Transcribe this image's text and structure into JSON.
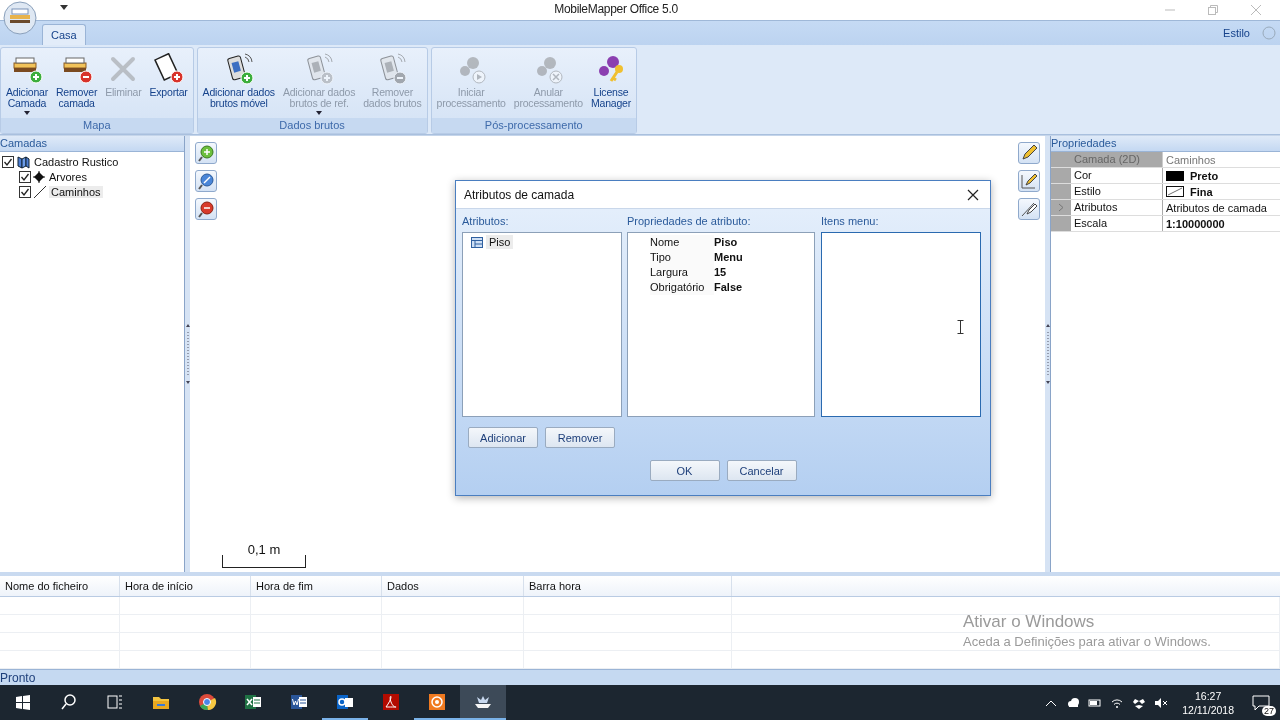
{
  "window": {
    "title": "MobileMapper Office 5.0"
  },
  "ribbon": {
    "tabs": [
      {
        "label": "Casa",
        "selected": true
      }
    ],
    "style_menu": {
      "label": "Estilo"
    },
    "groups": [
      {
        "label": "Mapa",
        "buttons": [
          {
            "label": "Adicionar\nCamada",
            "disabled": false,
            "dropdown": true
          },
          {
            "label": "Remover\ncamada",
            "disabled": false,
            "dropdown": false
          },
          {
            "label": "Eliminar",
            "disabled": true,
            "dropdown": false
          },
          {
            "label": "Exportar",
            "disabled": false,
            "dropdown": false
          }
        ]
      },
      {
        "label": "Dados brutos",
        "buttons": [
          {
            "label": "Adicionar dados\nbrutos móvel",
            "disabled": false,
            "dropdown": false
          },
          {
            "label": "Adicionar dados\nbrutos de ref.",
            "disabled": true,
            "dropdown": true
          },
          {
            "label": "Remover\ndados brutos",
            "disabled": true,
            "dropdown": false
          }
        ]
      },
      {
        "label": "Pós-processamento",
        "buttons": [
          {
            "label": "Iniciar\nprocessamento",
            "disabled": true,
            "dropdown": false
          },
          {
            "label": "Anular\nprocessamento",
            "disabled": true,
            "dropdown": false
          },
          {
            "label": "License\nManager",
            "disabled": false,
            "dropdown": false
          }
        ]
      }
    ]
  },
  "layers_panel": {
    "title": "Camadas",
    "tree": [
      {
        "label": "Cadastro Rustico",
        "kind": "group",
        "checked": true,
        "selected": false,
        "children": [
          {
            "label": "Arvores",
            "kind": "point",
            "checked": true,
            "selected": false
          },
          {
            "label": "Caminhos",
            "kind": "line",
            "checked": true,
            "selected": true
          }
        ]
      }
    ]
  },
  "map": {
    "scale": "0,1 m"
  },
  "properties_panel": {
    "title": "Propriedades",
    "rows": [
      {
        "name": "Camada (2D)",
        "value": "Caminhos",
        "kind": "header",
        "bold": false,
        "selected": false
      },
      {
        "name": "Cor",
        "value": "Preto",
        "kind": "color",
        "color": "#000000",
        "bold": true,
        "selected": false
      },
      {
        "name": "Estilo",
        "value": "Fina",
        "kind": "linestyle",
        "bold": true,
        "selected": false
      },
      {
        "name": "Atributos",
        "value": "Atributos de camada",
        "kind": "text",
        "bold": false,
        "selected": true
      },
      {
        "name": "Escala",
        "value": "1:10000000",
        "kind": "text",
        "bold": true,
        "selected": false
      }
    ]
  },
  "dialog": {
    "title": "Atributos de camada",
    "attributes": {
      "label": "Atributos:",
      "items": [
        {
          "label": "Piso",
          "selected": true
        }
      ]
    },
    "attribute_properties": {
      "label": "Propriedades de atributo:",
      "rows": [
        {
          "name": "Nome",
          "value": "Piso"
        },
        {
          "name": "Tipo",
          "value": "Menu"
        },
        {
          "name": "Largura",
          "value": "15"
        },
        {
          "name": "Obrigatório",
          "value": "False"
        }
      ]
    },
    "menu_items": {
      "label": "Itens menu:"
    },
    "list_buttons": [
      "Adicionar",
      "Remover"
    ],
    "buttons": [
      "OK",
      "Cancelar"
    ]
  },
  "files_table": {
    "columns": [
      "Nome do ficheiro",
      "Hora de início",
      "Hora de fim",
      "Dados",
      "Barra hora"
    ]
  },
  "activation_notice": {
    "title": "Ativar o Windows",
    "text": "Aceda a Definições para ativar o Windows."
  },
  "status_bar": "Pronto",
  "taskbar": {
    "apps": [
      {
        "kind": "start",
        "running": false,
        "selected": false
      },
      {
        "kind": "search",
        "running": false,
        "selected": false
      },
      {
        "kind": "taskview",
        "running": false,
        "selected": false
      },
      {
        "kind": "folder",
        "running": false,
        "selected": false
      },
      {
        "kind": "browser",
        "running": false,
        "selected": false
      },
      {
        "kind": "sheet",
        "running": false,
        "selected": false
      },
      {
        "kind": "doc",
        "running": false,
        "selected": false
      },
      {
        "kind": "mail",
        "running": true,
        "selected": false
      },
      {
        "kind": "pdf",
        "running": false,
        "selected": false
      },
      {
        "kind": "recorder",
        "running": true,
        "selected": false
      },
      {
        "kind": "mapper",
        "running": true,
        "selected": true
      }
    ],
    "time": "16:27",
    "date": "12/11/2018",
    "notifications": "27"
  }
}
